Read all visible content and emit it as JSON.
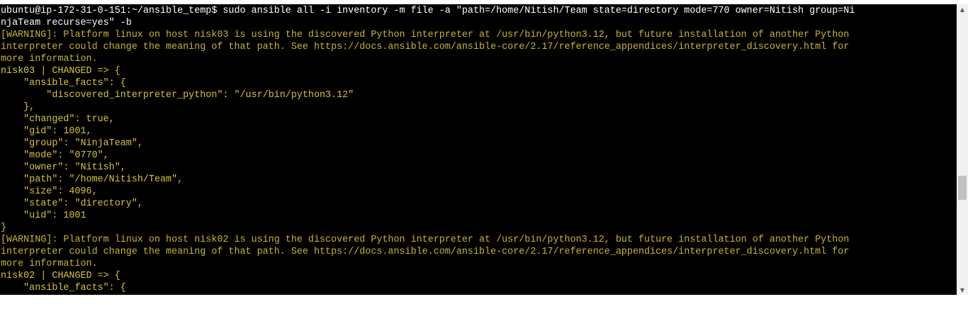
{
  "terminal": {
    "lines": [
      {
        "segments": [
          {
            "text": "ubuntu@ip-172-31-0-151:~/ansible_temp$ sudo ansible all -i inventory -m file -a \"path=/home/Nitish/Team state=directory mode=770 owner=Nitish group=Ni",
            "color": "white"
          }
        ]
      },
      {
        "segments": [
          {
            "text": "njaTeam recurse=yes\" -b",
            "color": "white"
          }
        ]
      },
      {
        "segments": [
          {
            "text": "[WARNING]: Platform linux on host nisk03 is using the discovered Python interpreter at /usr/bin/python3.12, but future installation of another Python",
            "color": "yellow"
          }
        ]
      },
      {
        "segments": [
          {
            "text": "interpreter could change the meaning of that path. See https://docs.ansible.com/ansible-core/2.17/reference_appendices/interpreter_discovery.html for",
            "color": "yellow"
          }
        ]
      },
      {
        "segments": [
          {
            "text": "more information.",
            "color": "yellow"
          }
        ]
      },
      {
        "segments": [
          {
            "text": "nisk03 | CHANGED => {",
            "color": "gold"
          }
        ]
      },
      {
        "segments": [
          {
            "text": "    \"ansible_facts\": {",
            "color": "gold"
          }
        ]
      },
      {
        "segments": [
          {
            "text": "        \"discovered_interpreter_python\": \"/usr/bin/python3.12\"",
            "color": "gold"
          }
        ]
      },
      {
        "segments": [
          {
            "text": "    },",
            "color": "gold"
          }
        ]
      },
      {
        "segments": [
          {
            "text": "    \"changed\": true,",
            "color": "gold"
          }
        ]
      },
      {
        "segments": [
          {
            "text": "    \"gid\": 1001,",
            "color": "gold"
          }
        ]
      },
      {
        "segments": [
          {
            "text": "    \"group\": \"NinjaTeam\",",
            "color": "gold"
          }
        ]
      },
      {
        "segments": [
          {
            "text": "    \"mode\": \"0770\",",
            "color": "gold"
          }
        ]
      },
      {
        "segments": [
          {
            "text": "    \"owner\": \"Nitish\",",
            "color": "gold"
          }
        ]
      },
      {
        "segments": [
          {
            "text": "    \"path\": \"/home/Nitish/Team\",",
            "color": "gold"
          }
        ]
      },
      {
        "segments": [
          {
            "text": "    \"size\": 4096,",
            "color": "gold"
          }
        ]
      },
      {
        "segments": [
          {
            "text": "    \"state\": \"directory\",",
            "color": "gold"
          }
        ]
      },
      {
        "segments": [
          {
            "text": "    \"uid\": 1001",
            "color": "gold"
          }
        ]
      },
      {
        "segments": [
          {
            "text": "}",
            "color": "gold"
          }
        ]
      },
      {
        "segments": [
          {
            "text": "[WARNING]: Platform linux on host nisk02 is using the discovered Python interpreter at /usr/bin/python3.12, but future installation of another Python",
            "color": "yellow"
          }
        ]
      },
      {
        "segments": [
          {
            "text": "interpreter could change the meaning of that path. See https://docs.ansible.com/ansible-core/2.17/reference_appendices/interpreter_discovery.html for",
            "color": "yellow"
          }
        ]
      },
      {
        "segments": [
          {
            "text": "more information.",
            "color": "yellow"
          }
        ]
      },
      {
        "segments": [
          {
            "text": "nisk02 | CHANGED => {",
            "color": "gold"
          }
        ]
      },
      {
        "segments": [
          {
            "text": "    \"ansible_facts\": {",
            "color": "gold"
          }
        ]
      }
    ]
  },
  "colors": {
    "background": "#000000",
    "white": "#ffffff",
    "yellow": "#c8b434",
    "gold": "#d7c43c"
  },
  "scrollbar": {
    "up_icon": "scroll-up-arrow-icon",
    "down_icon": "scroll-down-arrow-icon",
    "up_glyph": "▲",
    "down_glyph": "▼"
  }
}
